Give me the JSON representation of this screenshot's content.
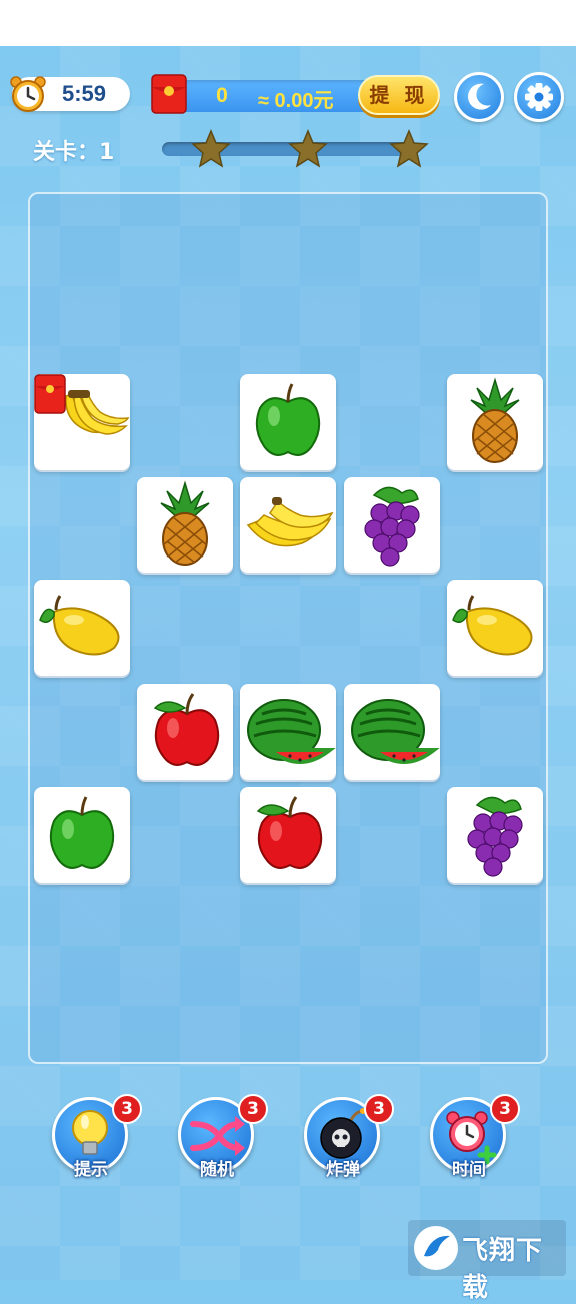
{
  "header": {
    "timer": "5:59",
    "cash_count": "0",
    "cash_amount": "≈ 0.00元",
    "withdraw_label": "提 现"
  },
  "level": {
    "label": "关卡：1",
    "stars": 3
  },
  "tiles": [
    {
      "fruit": "banana",
      "red_packet": true
    },
    {
      "fruit": "green-apple"
    },
    {
      "fruit": "pineapple"
    },
    {
      "fruit": "pineapple"
    },
    {
      "fruit": "banana"
    },
    {
      "fruit": "grapes"
    },
    {
      "fruit": "mango"
    },
    {
      "fruit": "mango"
    },
    {
      "fruit": "red-apple"
    },
    {
      "fruit": "watermelon"
    },
    {
      "fruit": "watermelon"
    },
    {
      "fruit": "green-apple"
    },
    {
      "fruit": "red-apple"
    },
    {
      "fruit": "grapes"
    }
  ],
  "tools": [
    {
      "label": "提示",
      "count": "3",
      "icon": "lightbulb-icon"
    },
    {
      "label": "随机",
      "count": "3",
      "icon": "shuffle-icon"
    },
    {
      "label": "炸弹",
      "count": "3",
      "icon": "bomb-icon"
    },
    {
      "label": "时间",
      "count": "3",
      "icon": "alarm-clock-plus-icon"
    }
  ],
  "watermark": {
    "text": "飞翔下载"
  },
  "colors": {
    "background": "#8fd0f3",
    "accent_yellow": "#ffe23e",
    "badge_red": "#e02020",
    "button_blue": "#1f7ee0"
  }
}
